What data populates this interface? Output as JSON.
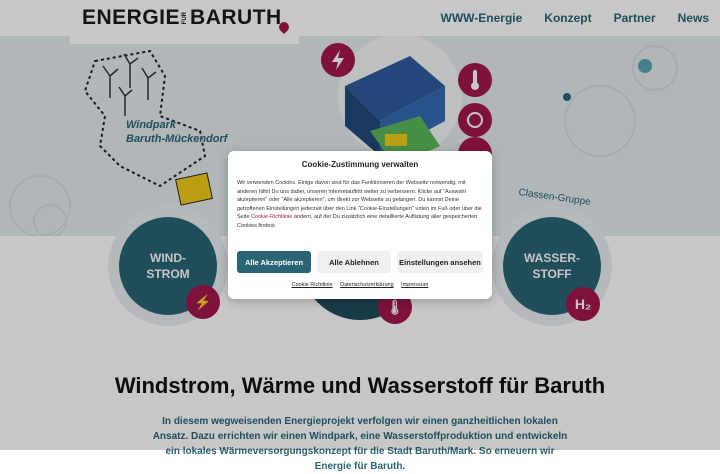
{
  "header": {
    "logo_main": "ENERGIE",
    "logo_small": "FÜR",
    "logo_end": "BARUTH",
    "nav": [
      "WWW-Energie",
      "Konzept",
      "Partner",
      "News"
    ]
  },
  "hero": {
    "windpark_label_1": "Windpark",
    "windpark_label_2": "Baruth-Mückendorf",
    "gruppe_label": "Classen-Gruppe",
    "circles": [
      {
        "line1": "WIND-",
        "line2": "STROM"
      },
      {
        "line1": "WASSER-",
        "line2": "STOFF"
      }
    ],
    "h2_badge": "H₂"
  },
  "content": {
    "title": "Windstrom, Wärme und Wasserstoff für Baruth",
    "paragraph": "In diesem wegweisenden Energieprojekt verfolgen wir einen ganzheitlichen lokalen Ansatz. Dazu errichten wir einen Windpark, eine Wasserstoffproduktion und entwickeln ein lokales Wärmeversorgungskonzept für die Stadt Baruth/Mark. So erneuern wir Energie für Baruth."
  },
  "cookie": {
    "title": "Cookie-Zustimmung verwalten",
    "body_1": "Wir verwenden Cookies. Einige davon sind für das Funktionieren der Webseite notwendig, mit anderen hilfst Du uns dabei, unseren Internetauftritt weiter zu verbessern. Klicke auf \"Auswahl akzeptieren\" oder \"Alle akzeptieren\", um direkt zur Webseite zu gelangen. Du kannst Deine getroffenen Einstellungen jederzeit über den Link \"Cookie-Einstellungen\" unten im Fuß oder über die Seite ",
    "body_link": "Cookie-Richtlinie",
    "body_2": " ändern, auf der Du zusätzlich eine detaillierte Auflistung aller gespeicherten Cookies findest.",
    "accept_all": "Alle Akzeptieren",
    "deny_all": "Alle Ablehnen",
    "settings": "Einstellungen ansehen",
    "links": [
      "Cookie Richtlinie",
      "Datenschutzerklärung",
      "Impressum"
    ]
  },
  "colors": {
    "teal": "#2a6575",
    "magenta": "#a3174f",
    "hero_bg": "#e3eaec"
  }
}
